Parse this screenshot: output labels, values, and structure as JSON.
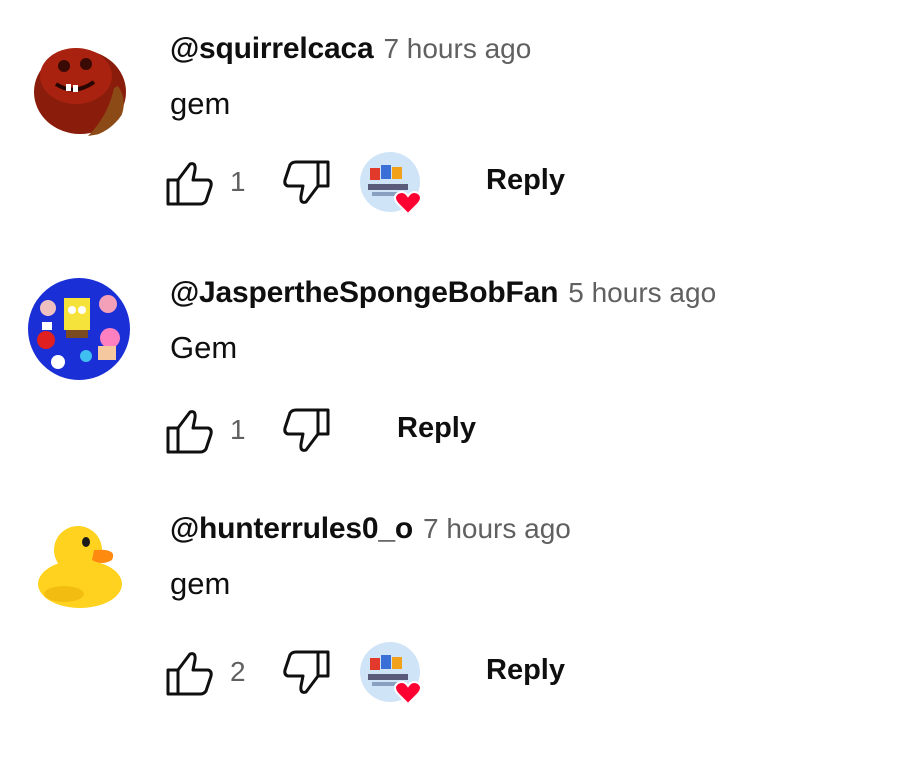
{
  "comments": [
    {
      "author": "@squirrelcaca",
      "time": "7 hours ago",
      "text": "gem",
      "likes": "1",
      "hearted": true,
      "reply_label": "Reply",
      "avatar": "red-cartoon-face-avatar"
    },
    {
      "author": "@JaspertheSpongeBobFan",
      "time": "5 hours ago",
      "text": "Gem",
      "likes": "1",
      "hearted": false,
      "reply_label": "Reply",
      "avatar": "cartoon-collage-avatar"
    },
    {
      "author": "@hunterrules0_o",
      "time": "7 hours ago",
      "text": "gem",
      "likes": "2",
      "hearted": true,
      "reply_label": "Reply",
      "avatar": "rubber-duck-avatar"
    }
  ],
  "icons": {
    "like": "thumbs-up-icon",
    "dislike": "thumbs-down-icon",
    "heart": "creator-heart-icon"
  },
  "colors": {
    "text": "#0f0f0f",
    "secondary": "#606060",
    "heart": "#ff0033",
    "avatar_bg_sponge": "#1a2fd6",
    "duck": "#ffd21f"
  }
}
